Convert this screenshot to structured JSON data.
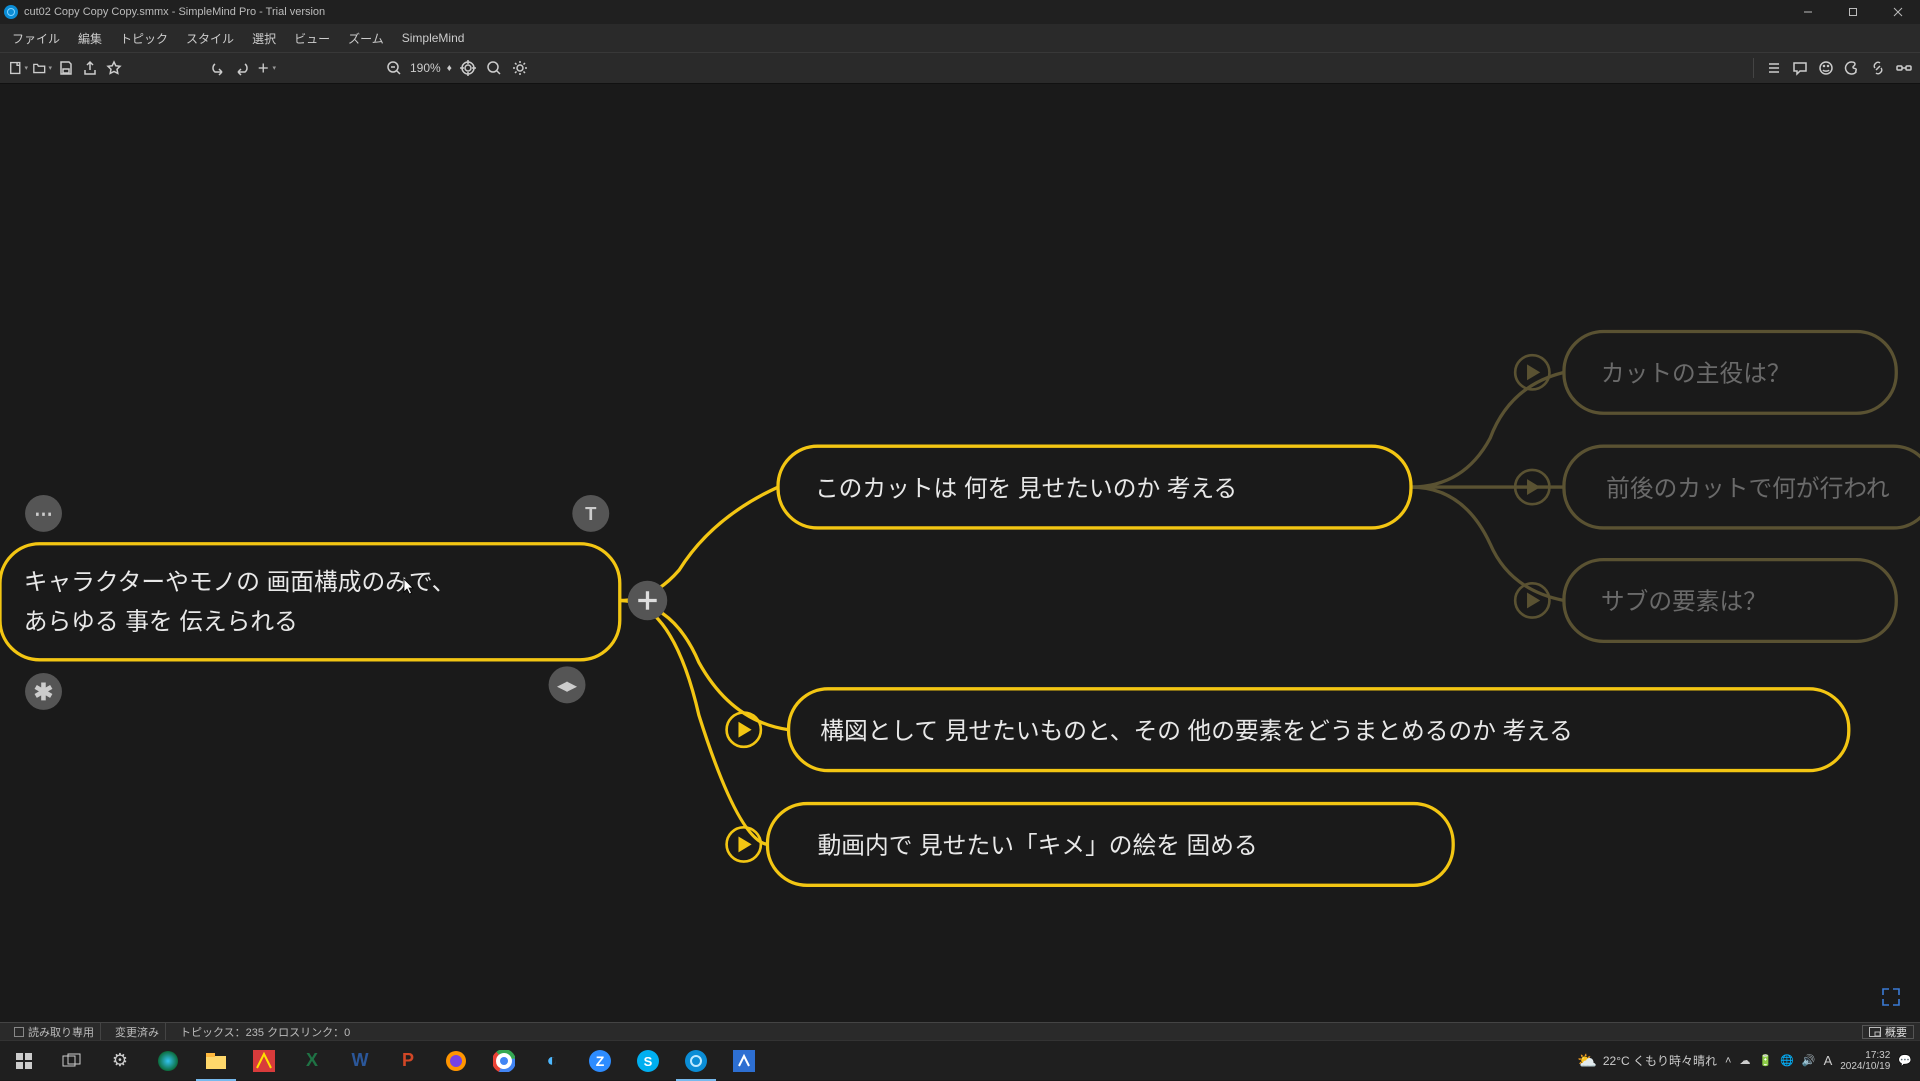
{
  "title": "cut02 Copy Copy Copy.smmx - SimpleMind Pro - Trial version",
  "menu": [
    "ファイル",
    "編集",
    "トピック",
    "スタイル",
    "選択",
    "ビュー",
    "ズーム",
    "SimpleMind"
  ],
  "toolbar": {
    "zoom": "190%"
  },
  "mindmap": {
    "root_line1": "キャラクターやモノの 画面構成のみで、",
    "root_line2": "あらゆる 事を 伝えられる",
    "c1": "このカットは 何を 見せたいのか 考える",
    "c2": "構図として 見せたいものと、その 他の要素をどうまとめるのか 考える",
    "c3": "動画内で 見せたい「キメ」の絵を 固める",
    "g1": "カットの主役は？",
    "g2": "前後のカットで何が行われ",
    "g3": "サブの要素は？"
  },
  "status": {
    "readonly": "読み取り専用",
    "changed": "変更済み",
    "topics": "トピックス：235 クロスリンク：0",
    "overview": "概要"
  },
  "tray": {
    "weather": "22°C  くもり時々晴れ",
    "time": "17:32",
    "date": "2024/10/19"
  }
}
